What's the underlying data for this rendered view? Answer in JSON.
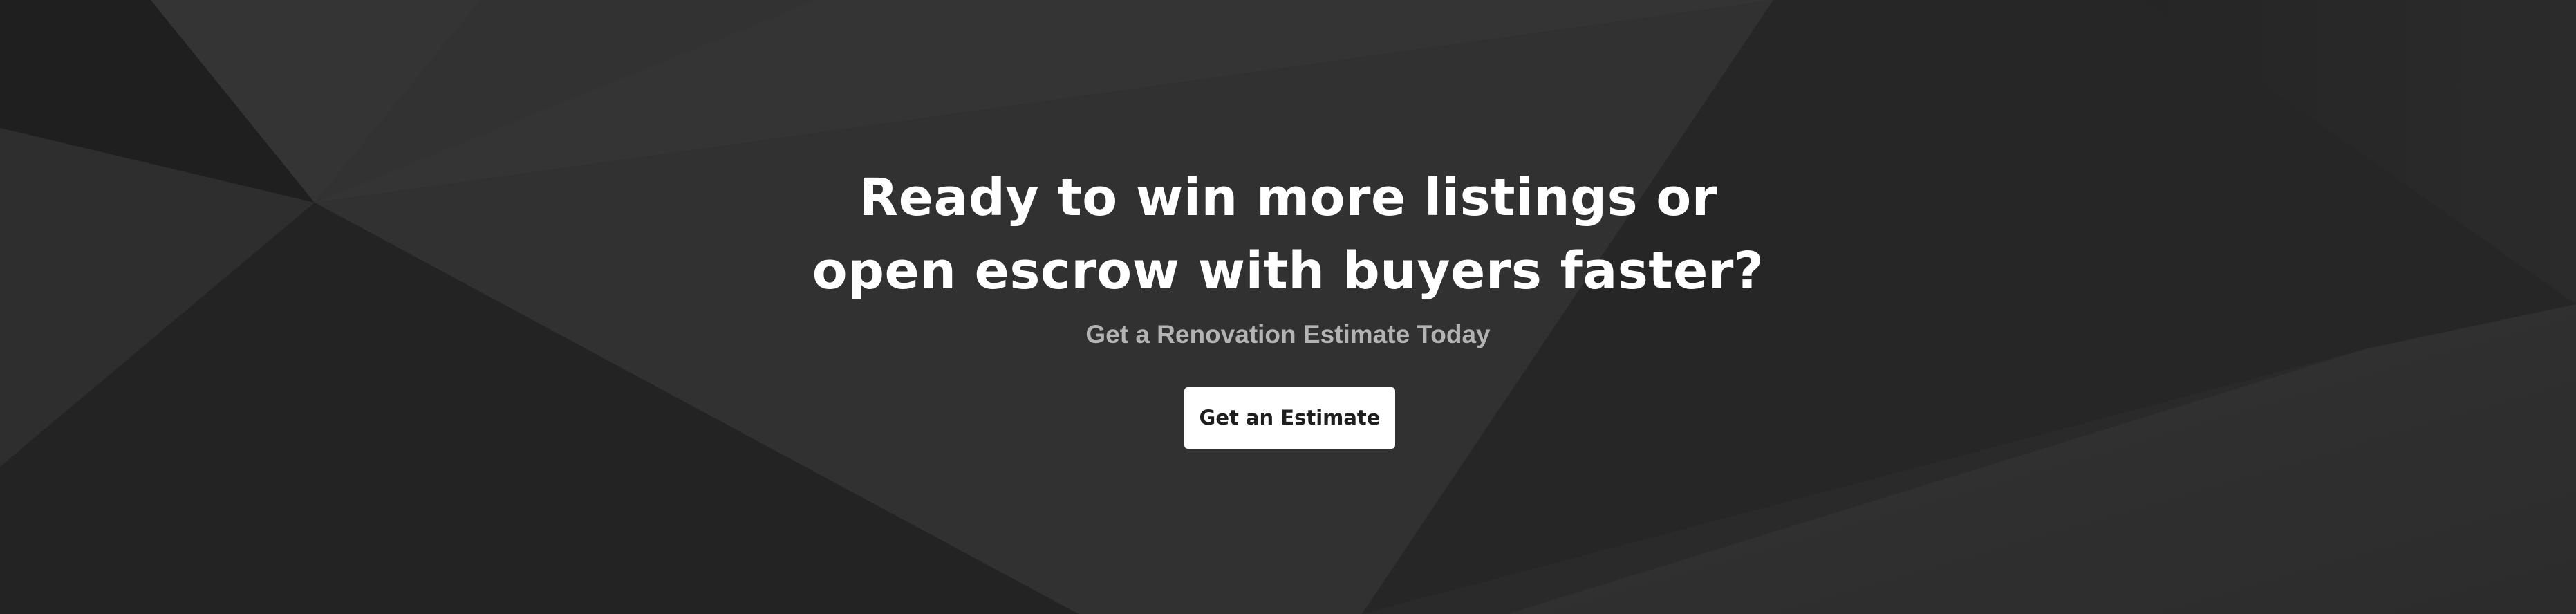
{
  "hero": {
    "headline_line1": "Ready to win more listings or",
    "headline_line2": "open escrow with buyers faster?",
    "subheading": "Get a Renovation Estimate Today",
    "cta_label": "Get an Estimate"
  },
  "colors": {
    "background": "#272727",
    "headline": "#ffffff",
    "subheading": "#b3b3b3",
    "button_bg": "#ffffff",
    "button_text": "#1f1f1f"
  }
}
